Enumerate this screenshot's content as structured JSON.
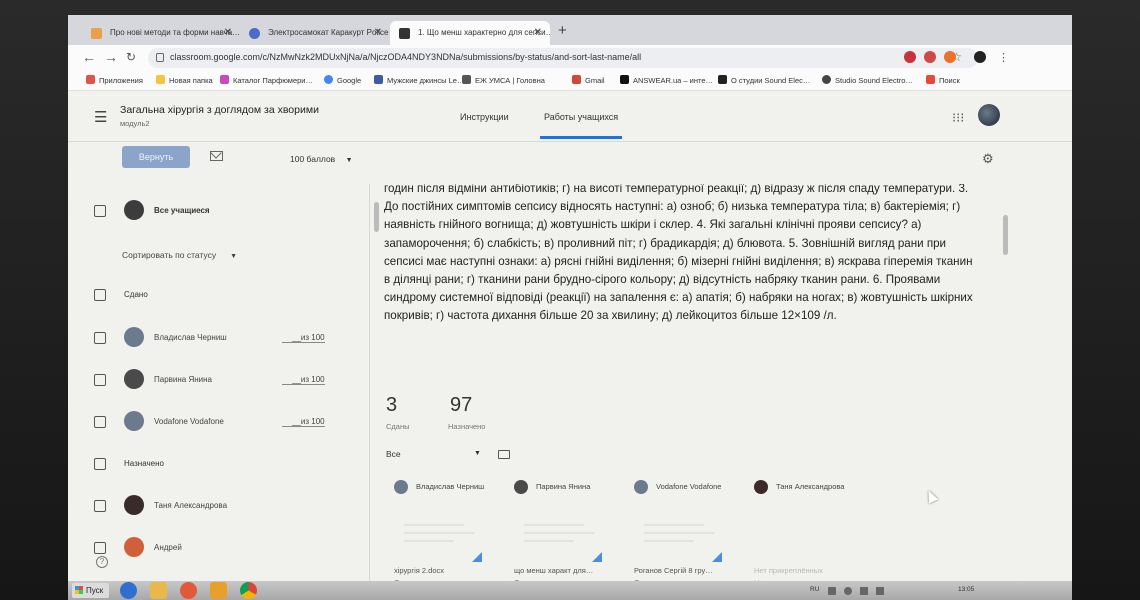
{
  "browser": {
    "tabs": [
      {
        "title": "Про нові методи та форми навча…",
        "color": "#e8a04a"
      },
      {
        "title": "Электросамокат Каракурт Police Bl…",
        "color": "#4a6cc8"
      },
      {
        "title": "1. Що менш характерно для сепси…",
        "color": "#333333"
      }
    ],
    "new_tab": "+",
    "url": "classroom.google.com/c/NzMwNzk2MDUxNjNa/a/NjczODA4NDY3NDNa/submissions/by-status/and-sort-last-name/all",
    "bookmarks": [
      {
        "label": "Приложения",
        "color": "#e0534a"
      },
      {
        "label": "Новая папка",
        "color": "#f4c542"
      },
      {
        "label": "Каталог Парфюмери…",
        "color": "#c54bbf"
      },
      {
        "label": "Google",
        "color": "#4285f4"
      },
      {
        "label": "Мужские джинсы Le…",
        "color": "#3b5aa8"
      },
      {
        "label": "ЕЖ УМСА | Головна",
        "color": "#555555"
      },
      {
        "label": "Gmail",
        "color": "#d44638"
      },
      {
        "label": "ANSWEAR.ua – инте…",
        "color": "#111111"
      },
      {
        "label": "О студии Sound Elec…",
        "color": "#222222"
      },
      {
        "label": "Studio Sound Electro…",
        "color": "#444444"
      },
      {
        "label": "Поиск",
        "color": "#e84a3a"
      }
    ]
  },
  "header": {
    "course_title": "Загальна хірургія з доглядом за хворими",
    "course_subtitle": "модуль2",
    "tabs": [
      "Инструкции",
      "Работы учащихся"
    ]
  },
  "actions": {
    "return_label": "Вернуть",
    "points_label": "100 баллов"
  },
  "left": {
    "all_students": "Все учащиеся",
    "sort_label": "Сортировать по статусу",
    "section_done": "Сдано",
    "done_students": [
      {
        "name": "Владислав Черниш",
        "score": "__из 100",
        "color": "#6b7a8c"
      },
      {
        "name": "Парвина Янина",
        "score": "__из 100",
        "color": "#4a4a4a"
      },
      {
        "name": "Vodafone Vodafone",
        "score": "__из 100",
        "color": "#6b7a8c"
      }
    ],
    "section_assigned": "Назначено",
    "assigned_students": [
      {
        "name": "Таня Александрова",
        "color": "#3a2a2a"
      },
      {
        "name": "Андрей",
        "color": "#d0603a"
      }
    ],
    "help": "?"
  },
  "question": {
    "text": "годин після відміни антибіотиків; г) на висоті температурної реакції; д) відразу ж після спаду температури. 3. До постійних симптомів сепсису відносять наступні: а) озноб; б) низька температура тіла; в) бактеріемія; г) наявність гнійного вогнища; д) жовтушність шкіри і склер. 4. Які загальні клінічні прояви сепсису? а) запаморочення; б) слабкість; в) проливний піт; г) брадикардія; д) блювота. 5. Зовнішній вигляд рани при сепсисі має наступні ознаки: а) рясні гнійні виділення; б) мізерні гнійні виділення; в) яскрава гіперемія тканин в ділянці рани; г) тканини рани брудно-сірого кольору; д) відсутність набряку тканин рани. 6. Проявами синдрому системної відповіді (реакції) на запалення є: а) апатія; б) набряки на ногах; в) жовтушність шкірних покривів; г) частота дихання більше 20 за хвилину; д) лейкоцитоз більше 12×109 /л."
  },
  "stats": {
    "submitted_count": "3",
    "submitted_label": "Сданы",
    "assigned_count": "97",
    "assigned_label": "Назначено"
  },
  "filter": {
    "label": "Все"
  },
  "cards": [
    {
      "name": "Владислав Черниш",
      "file": "хірургія 2.docx",
      "status": "Сдано",
      "color": "#6b7a8c",
      "faded": false,
      "has_thumb": true
    },
    {
      "name": "Парвина Янина",
      "file": "що менш характ для…",
      "status": "Сдано",
      "color": "#4a4a4a",
      "faded": false,
      "has_thumb": true
    },
    {
      "name": "Vodafone Vodafone",
      "file": "Роганов Сергій 8 гру…",
      "status": "Сдано",
      "color": "#6b7a8c",
      "faded": false,
      "has_thumb": true
    },
    {
      "name": "Таня Александрова",
      "file": "Нет прикреплённых",
      "status": "Назначено",
      "color": "#3a2a2a",
      "faded": true,
      "has_thumb": false
    }
  ],
  "taskbar": {
    "start_label": "Пуск",
    "tray_lang": "RU",
    "tray_time": "13:05"
  }
}
